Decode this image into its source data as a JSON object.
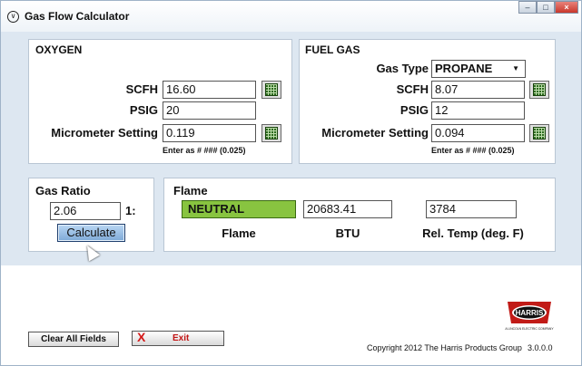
{
  "window": {
    "title": "Gas Flow Calculator",
    "controls": [
      "minimize",
      "maximize",
      "close"
    ]
  },
  "oxygen": {
    "title": "OXYGEN",
    "scfh_label": "SCFH",
    "scfh_value": "16.60",
    "psig_label": "PSIG",
    "psig_value": "20",
    "micrometer_label": "Micrometer Setting",
    "micrometer_value": "0.119",
    "hint": "Enter as # ### (0.025)"
  },
  "fuel": {
    "title": "FUEL GAS",
    "gas_type_label": "Gas Type",
    "gas_type_value": "PROPANE",
    "scfh_label": "SCFH",
    "scfh_value": "8.07",
    "psig_label": "PSIG",
    "psig_value": "12",
    "micrometer_label": "Micrometer Setting",
    "micrometer_value": "0.094",
    "hint": "Enter as # ### (0.025)"
  },
  "ratio": {
    "title": "Gas Ratio",
    "value": "2.06",
    "suffix": "1:",
    "calculate_label": "Calculate"
  },
  "flame": {
    "title": "Flame",
    "flame_value": "NEUTRAL",
    "btu_value": "20683.41",
    "temp_value": "3784",
    "flame_caption": "Flame",
    "btu_caption": "BTU",
    "temp_caption": "Rel. Temp (deg. F)",
    "status_color": "#88c440"
  },
  "footer": {
    "clear_label": "Clear All Fields",
    "exit_label": "Exit",
    "copyright": "Copyright 2012 The Harris Products Group",
    "version": "3.0.0.0",
    "logo_text": "HARRIS",
    "logo_subtext": "A LINCOLN ELECTRIC COMPANY"
  }
}
